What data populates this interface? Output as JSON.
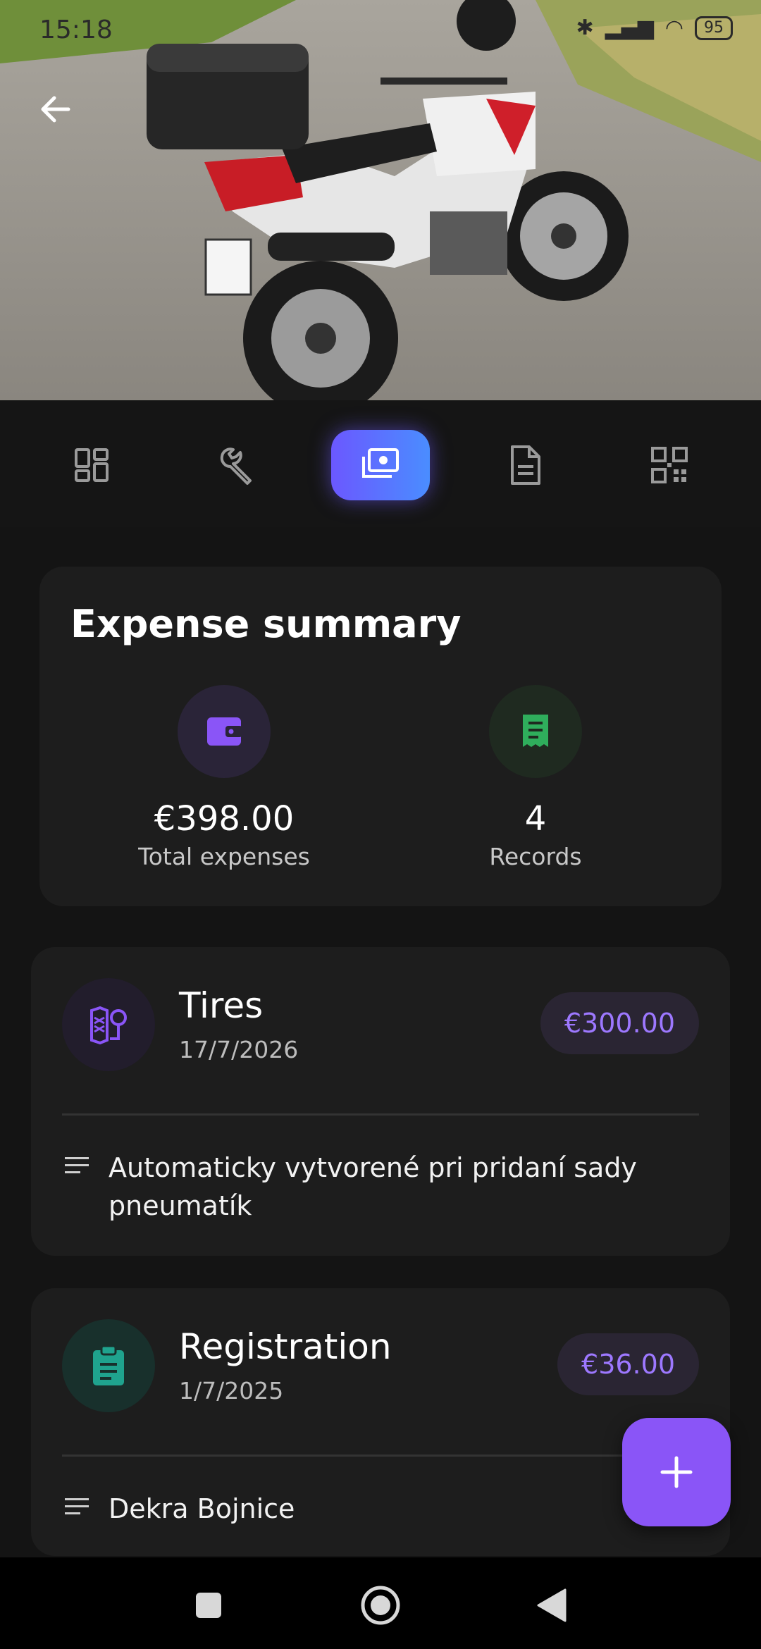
{
  "status": {
    "time": "15:18",
    "battery": "95"
  },
  "tabs": [
    {
      "name": "overview",
      "active": false
    },
    {
      "name": "maintenance",
      "active": false
    },
    {
      "name": "expenses",
      "active": true
    },
    {
      "name": "documents",
      "active": false
    },
    {
      "name": "qr-code",
      "active": false
    }
  ],
  "summary": {
    "title": "Expense summary",
    "total_value": "€398.00",
    "total_label": "Total expenses",
    "records_value": "4",
    "records_label": "Records"
  },
  "expenses": [
    {
      "title": "Tires",
      "date": "17/7/2026",
      "amount": "€300.00",
      "note": "Automaticky vytvorené pri pridaní sady pneumatík",
      "icon": "tire-icon"
    },
    {
      "title": "Registration",
      "date": "1/7/2025",
      "amount": "€36.00",
      "note": "Dekra Bojnice",
      "icon": "clipboard-icon"
    }
  ],
  "colors": {
    "accent": "#8a55f7",
    "amount_text": "#9d78ff",
    "green_icon": "#2fae5c",
    "teal_icon": "#1fa38e"
  }
}
